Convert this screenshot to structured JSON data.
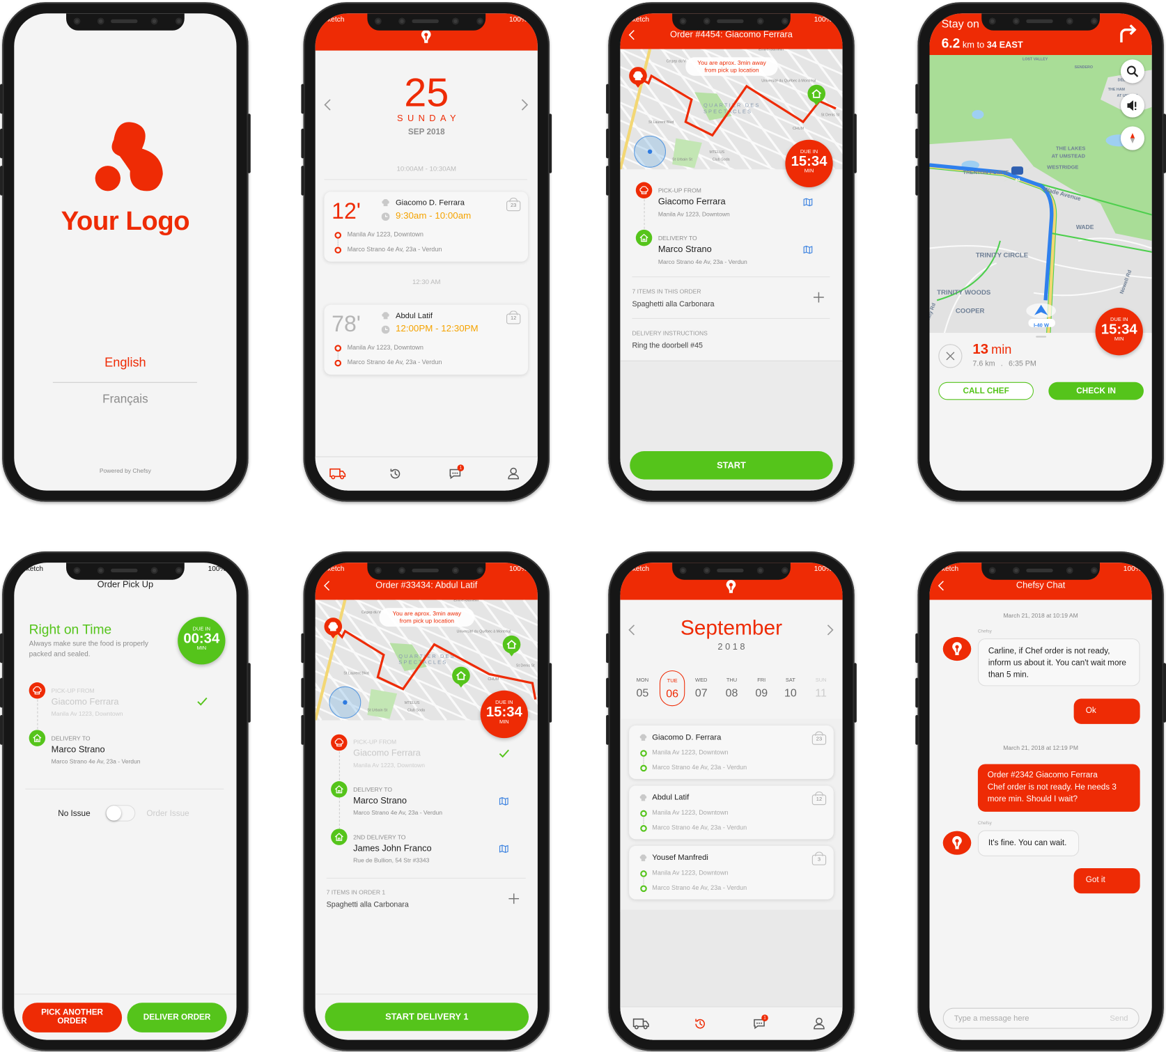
{
  "colors": {
    "brand_red": "#ee2b05",
    "green": "#55c41b",
    "orange": "#f5a300",
    "map_icon_blue": "#3b82e0"
  },
  "status_bar": {
    "carrier": "Sketch",
    "battery": "100%"
  },
  "splash": {
    "logo_text": "Your Logo",
    "languages": [
      "English",
      "Français"
    ],
    "powered_by": "Powered by Chefsy"
  },
  "schedule": {
    "day": "25",
    "weekday": "SUNDAY",
    "month_year": "SEP 2018",
    "slots": [
      {
        "label": "10:00AM - 10:30AM",
        "card": {
          "minutes": "12'",
          "chef": "Giacomo D. Ferrara",
          "time": "9:30am - 10:00am",
          "pickup": "Manila Av 1223, Downtown",
          "dropoff": "Marco Strano  4e Av, 23a - Verdun",
          "items": "23"
        }
      },
      {
        "label": "12:30 AM",
        "card": {
          "minutes": "78'",
          "chef": "Abdul Latif",
          "time": "12:00PM - 12:30PM",
          "pickup": "Manila Av 1223, Downtown",
          "dropoff": "Marco Strano  4e Av, 23a - Verdun",
          "items": "12"
        }
      }
    ],
    "notification_count": "1"
  },
  "order_detail": {
    "title": "Order #4454: Giacomo Ferrara",
    "map_bubble": [
      "You are aprox. 3min away",
      "from pick up location"
    ],
    "map_labels": [
      "Cégep du V",
      "Emilie-Gamelin",
      "Université du Québec à Montréal",
      "QUARTIER DES",
      "SPECTACLES",
      "St Laurent Blvd",
      "MTELUS",
      "Club Soda",
      "CHUM",
      "St Denis St",
      "St Urbain St"
    ],
    "due": {
      "label": "DUE IN",
      "time": "15:34",
      "unit": "MIN"
    },
    "pickup": {
      "label": "PICK-UP FROM",
      "name": "Giacomo Ferrara",
      "address": "Manila Av 1223, Downtown"
    },
    "delivery": {
      "label": "DELIVERY TO",
      "name": "Marco Strano",
      "address": "Marco Strano  4e Av, 23a - Verdun"
    },
    "items": {
      "label": "7 ITEMS IN THIS ORDER",
      "value": "Spaghetti alla Carbonara"
    },
    "instructions": {
      "label": "DELIVERY INSTRUCTIONS",
      "value": "Ring the doorbell #45"
    },
    "start_label": "START"
  },
  "navigation": {
    "instruction": "Stay on",
    "distance": "6.2",
    "distance_unit": "km to",
    "road": "34 EAST",
    "map_labels": [
      "LOST VALLEY",
      "SENDERO",
      "DELTA",
      "THE HAM",
      "AT UMSTEA",
      "THE LAKES",
      "AT UMSTEAD",
      "WESTRIDGE",
      "TRENTON POINTE",
      "40",
      "Wade Avenue",
      "WADE",
      "TRINITY CIRCLE",
      "TRINITY WOODS",
      "COOPER",
      "I-40 W",
      "Nowell Rd",
      "nity Rd"
    ],
    "due": {
      "label": "DUE IN",
      "time": "15:34",
      "unit": "MIN"
    },
    "eta_value": "13",
    "eta_unit": "min",
    "trip_distance": "7.6 km",
    "separator": ".",
    "arrival": "6:35 PM",
    "call_chef": "CALL CHEF",
    "check_in": "CHECK IN"
  },
  "pickup_screen": {
    "title": "Order Pick Up",
    "status": "Right on Time",
    "description": [
      "Always make sure the food is properly",
      "packed and sealed."
    ],
    "due": {
      "label": "DUE IN",
      "time": "00:34",
      "unit": "MIN"
    },
    "pickup": {
      "label": "PICK-UP FROM",
      "name": "Giacomo Ferrara",
      "address": "Manila Av 1223, Downtown",
      "done": true
    },
    "delivery": {
      "label": "DELIVERY TO",
      "name": "Marco Strano",
      "address": "Marco Strano  4e Av, 23a - Verdun"
    },
    "toggle": {
      "off_label": "No Issue",
      "on_label": "Order Issue",
      "on": false
    },
    "pick_another": [
      "PICK ANOTHER",
      "ORDER"
    ],
    "deliver": "DELIVER ORDER"
  },
  "order_delivery": {
    "title": "Order #33434: Abdul Latif",
    "map_bubble": [
      "You are aprox. 3min away",
      "from pick up location"
    ],
    "due": {
      "label": "DUE IN",
      "time": "15:34",
      "unit": "MIN"
    },
    "pickup": {
      "label": "PICK-UP FROM",
      "name": "Giacomo Ferrara",
      "address": "Manila Av 1223, Downtown",
      "done": true
    },
    "delivery": {
      "label": "DELIVERY TO",
      "name": "Marco Strano",
      "address": "Marco Strano  4e Av, 23a - Verdun"
    },
    "delivery2": {
      "label": "2ND DELIVERY TO",
      "name": "James John Franco",
      "address": "Rue de Bullion, 54 Str #3343"
    },
    "items": {
      "label": "7 ITEMS IN ORDER 1",
      "value": "Spaghetti alla Carbonara"
    },
    "start_label": "START DELIVERY 1"
  },
  "calendar": {
    "month": "September",
    "year": "2 0 1 8",
    "days": [
      {
        "name": "MON",
        "num": "05"
      },
      {
        "name": "TUE",
        "num": "06",
        "selected": true
      },
      {
        "name": "WED",
        "num": "07"
      },
      {
        "name": "THU",
        "num": "08"
      },
      {
        "name": "FRI",
        "num": "09"
      },
      {
        "name": "SAT",
        "num": "10"
      },
      {
        "name": "SUN",
        "num": "11"
      }
    ],
    "orders": [
      {
        "chef": "Giacomo D. Ferrara",
        "pickup": "Manila Av 1223, Downtown",
        "dropoff": "Marco Strano  4e Av, 23a - Verdun",
        "items": "23"
      },
      {
        "chef": "Abdul Latif",
        "pickup": "Manila Av 1223, Downtown",
        "dropoff": "Marco Strano  4e Av, 23a - Verdun",
        "items": "12"
      },
      {
        "chef": "Yousef Manfredi",
        "pickup": "Manila Av 1223, Downtown",
        "dropoff": "Marco Strano  4e Av, 23a - Verdun",
        "items": "3"
      }
    ],
    "notification_count": "1"
  },
  "chat": {
    "title": "Chefsy Chat",
    "messages": [
      {
        "type": "timestamp",
        "text": "March 21, 2018 at 10:19 AM"
      },
      {
        "type": "in",
        "sender": "Chefsy",
        "text": "Carline, if Chef order is not ready, inform us about it. You can't wait more than 5 min."
      },
      {
        "type": "out",
        "text": "Ok"
      },
      {
        "type": "timestamp",
        "text": "March 21, 2018 at 12:19 PM"
      },
      {
        "type": "out",
        "title": "Order #2342 Giacomo Ferrara",
        "text": "Chef order is not ready. He needs 3 more min. Should I wait?"
      },
      {
        "type": "in",
        "sender": "Chefsy",
        "text": "It's fine. You can wait."
      },
      {
        "type": "out",
        "text": "Got it"
      }
    ],
    "input_placeholder": "Type a message here",
    "send_label": "Send"
  }
}
